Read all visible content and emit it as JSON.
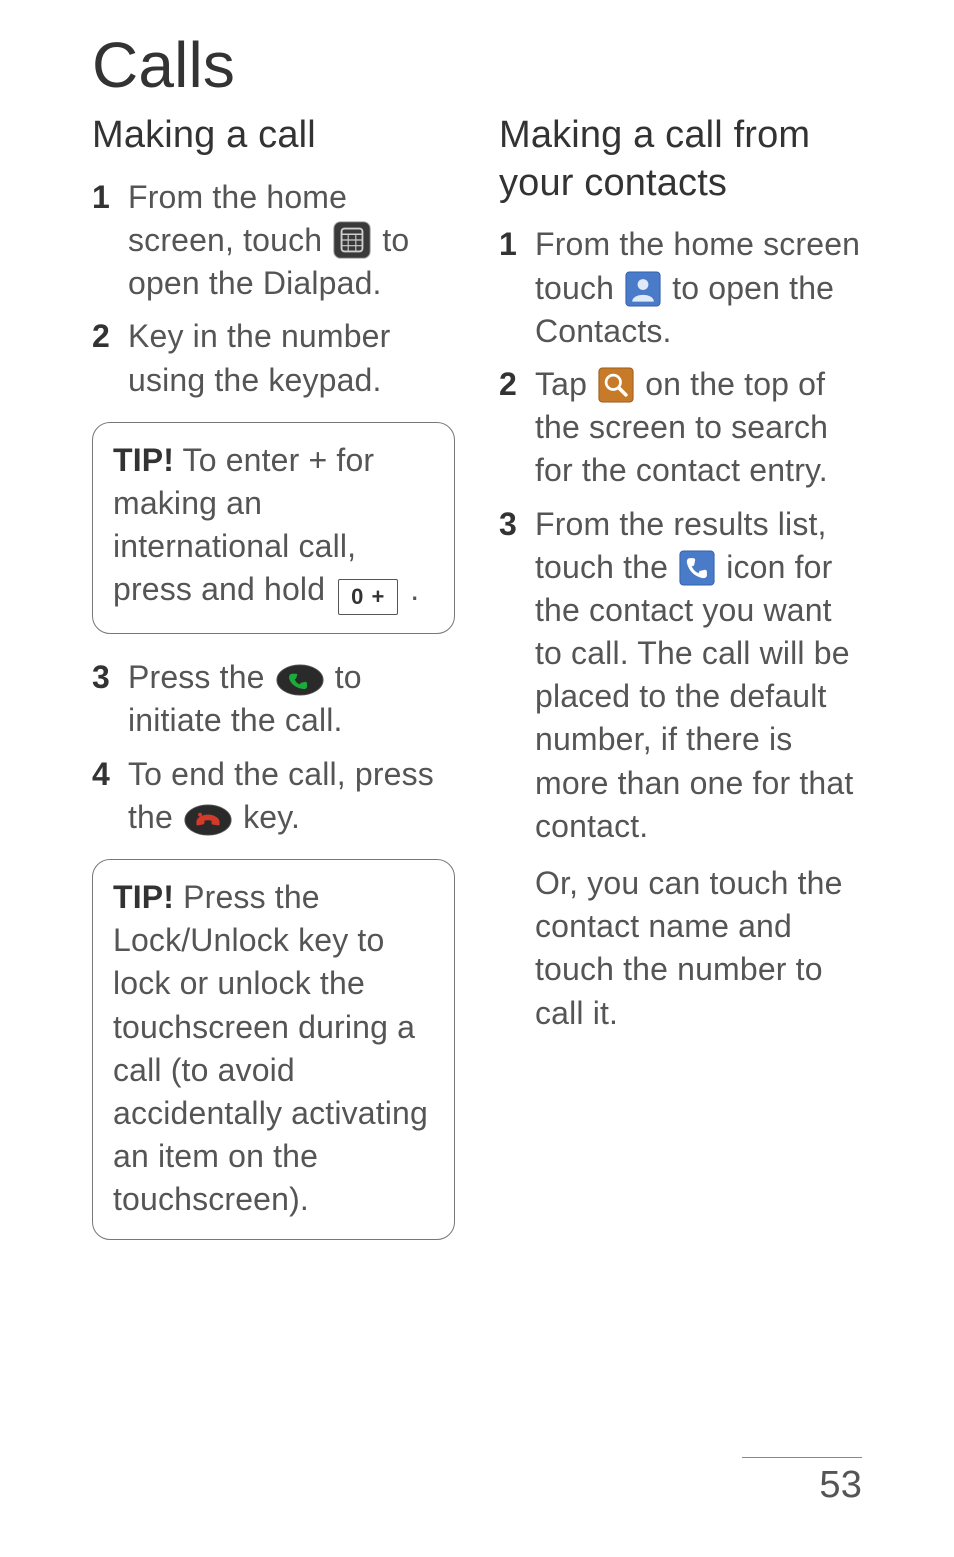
{
  "title": "Calls",
  "page_number": "53",
  "tip_label": "TIP!",
  "left": {
    "heading": "Making a call",
    "items": [
      {
        "num": "1",
        "pre": "From the home screen, touch ",
        "post": " to open the Dialpad.",
        "icon": "dialpad-icon"
      },
      {
        "num": "2",
        "text": "Key in the number using the keypad."
      }
    ],
    "tip1": {
      "text_before": " To enter + for making an international call, press and hold ",
      "key_label": "0 +",
      "text_after": " ."
    },
    "items2": [
      {
        "num": "3",
        "pre": "Press the ",
        "post": " to initiate the call.",
        "icon": "call-send-key-icon"
      },
      {
        "num": "4",
        "pre": "To end the call, press the ",
        "post": " key.",
        "icon": "call-end-key-icon"
      }
    ],
    "tip2": {
      "text": " Press the Lock/Unlock key to lock or unlock the touchscreen during a call (to avoid accidentally activating an item on the touchscreen)."
    }
  },
  "right": {
    "heading": "Making a call from your contacts",
    "items": [
      {
        "num": "1",
        "pre": "From the home screen touch ",
        "post": " to open the Contacts.",
        "icon": "contacts-icon"
      },
      {
        "num": "2",
        "pre": "Tap ",
        "post": " on the top of the screen to search for the contact entry.",
        "icon": "search-icon"
      },
      {
        "num": "3",
        "pre": "From the results list, touch the ",
        "post": " icon for the contact you want to call. The call will be placed to the default number, if there is more than one for that contact.",
        "followup": "Or, you can touch the contact name and touch the number to call it.",
        "icon": "call-icon"
      }
    ]
  }
}
